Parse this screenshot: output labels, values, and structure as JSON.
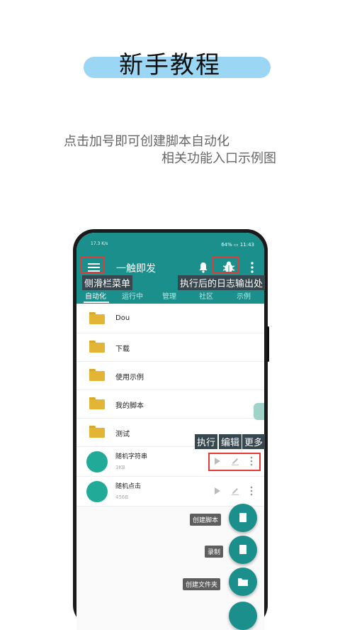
{
  "header": {
    "title": "新手教程",
    "desc_line1": "点击加号即可创建脚本自动化",
    "desc_line2": "相关功能入口示例图"
  },
  "status_bar": {
    "left": "17.3 K/s",
    "right": "64% ▭ 11:43"
  },
  "app": {
    "title": "一触即发",
    "tabs": [
      "自动化",
      "运行中",
      "管理",
      "社区",
      "示例"
    ],
    "active_tab": "自动化"
  },
  "annotations": {
    "menu_label": "侧滑栏菜单",
    "log_label": "执行后的日志输出处",
    "run_label": "执行",
    "edit_label": "编辑",
    "more_label": "更多"
  },
  "folders": [
    "Dou",
    "下载",
    "使用示例",
    "我的脚本",
    "测试"
  ],
  "scripts": [
    {
      "name": "随机字符串",
      "size": "3KB"
    },
    {
      "name": "随机点击",
      "size": "456B"
    }
  ],
  "fab_menu": {
    "create_script": "创建脚本",
    "record": "录制",
    "create_folder": "创建文件夹"
  },
  "colors": {
    "accent": "#1a8f8c",
    "title_pill": "#9bd7f4",
    "folder": "#e2b634",
    "highlight": "#e53935"
  }
}
